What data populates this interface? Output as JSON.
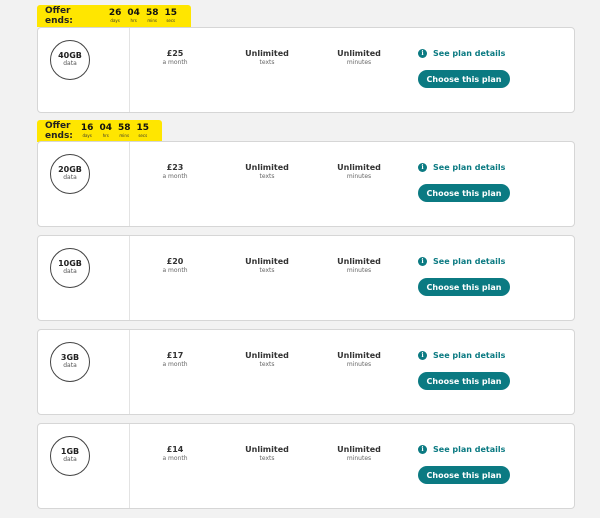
{
  "plans": [
    {
      "offer": {
        "label": "Offer ends:",
        "days": "26",
        "hrs": "04",
        "mins": "58",
        "secs": "15"
      },
      "data": "40GB",
      "data_unit": "data",
      "price": "£25",
      "price_unit": "a month",
      "texts": "Unlimited",
      "texts_unit": "texts",
      "minutes": "Unlimited",
      "minutes_unit": "minutes",
      "details": "See plan details",
      "cta": "Choose this plan"
    },
    {
      "offer": {
        "label": "Offer ends:",
        "days": "16",
        "hrs": "04",
        "mins": "58",
        "secs": "15"
      },
      "data": "20GB",
      "data_unit": "data",
      "price": "£23",
      "price_unit": "a month",
      "texts": "Unlimited",
      "texts_unit": "texts",
      "minutes": "Unlimited",
      "minutes_unit": "minutes",
      "details": "See plan details",
      "cta": "Choose this plan"
    },
    {
      "data": "10GB",
      "data_unit": "data",
      "price": "£20",
      "price_unit": "a month",
      "texts": "Unlimited",
      "texts_unit": "texts",
      "minutes": "Unlimited",
      "minutes_unit": "minutes",
      "details": "See plan details",
      "cta": "Choose this plan"
    },
    {
      "data": "3GB",
      "data_unit": "data",
      "price": "£17",
      "price_unit": "a month",
      "texts": "Unlimited",
      "texts_unit": "texts",
      "minutes": "Unlimited",
      "minutes_unit": "minutes",
      "details": "See plan details",
      "cta": "Choose this plan"
    },
    {
      "data": "1GB",
      "data_unit": "data",
      "price": "£14",
      "price_unit": "a month",
      "texts": "Unlimited",
      "texts_unit": "texts",
      "minutes": "Unlimited",
      "minutes_unit": "minutes",
      "details": "See plan details",
      "cta": "Choose this plan"
    }
  ],
  "countdown_units": {
    "days": "days",
    "hrs": "hrs",
    "mins": "mins",
    "secs": "secs"
  },
  "colors": {
    "accent": "#0b7a82",
    "banner": "#ffe600"
  }
}
